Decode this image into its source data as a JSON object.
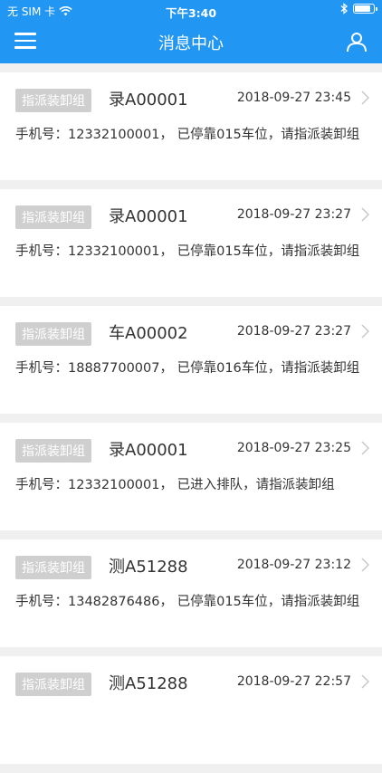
{
  "status": {
    "carrier": "无 SIM 卡",
    "time": "下午3:40",
    "battery_level": 0.9
  },
  "navbar": {
    "title": "消息中心",
    "menu_icon": "hamburger-menu-icon",
    "user_icon": "user-profile-icon"
  },
  "messages": [
    {
      "badge": "指派装卸组",
      "plate": "录A00001",
      "time": "2018-09-27 23:45",
      "text": "手机号：12332100001， 已停靠015车位，请指派装卸组"
    },
    {
      "badge": "指派装卸组",
      "plate": "录A00001",
      "time": "2018-09-27 23:27",
      "text": "手机号：12332100001， 已停靠015车位，请指派装卸组"
    },
    {
      "badge": "指派装卸组",
      "plate": "车A00002",
      "time": "2018-09-27 23:27",
      "text": "手机号：18887700007， 已停靠016车位，请指派装卸组"
    },
    {
      "badge": "指派装卸组",
      "plate": "录A00001",
      "time": "2018-09-27 23:25",
      "text": "手机号：12332100001， 已进入排队，请指派装卸组"
    },
    {
      "badge": "指派装卸组",
      "plate": "测A51288",
      "time": "2018-09-27 23:12",
      "text": "手机号：13482876486， 已停靠015车位，请指派装卸组"
    },
    {
      "badge": "指派装卸组",
      "plate": "测A51288",
      "time": "2018-09-27 22:57",
      "text": ""
    }
  ],
  "colors": {
    "primary": "#2196f3",
    "badge_bg": "#cfcfcf",
    "page_bg": "#f0f0f0"
  }
}
